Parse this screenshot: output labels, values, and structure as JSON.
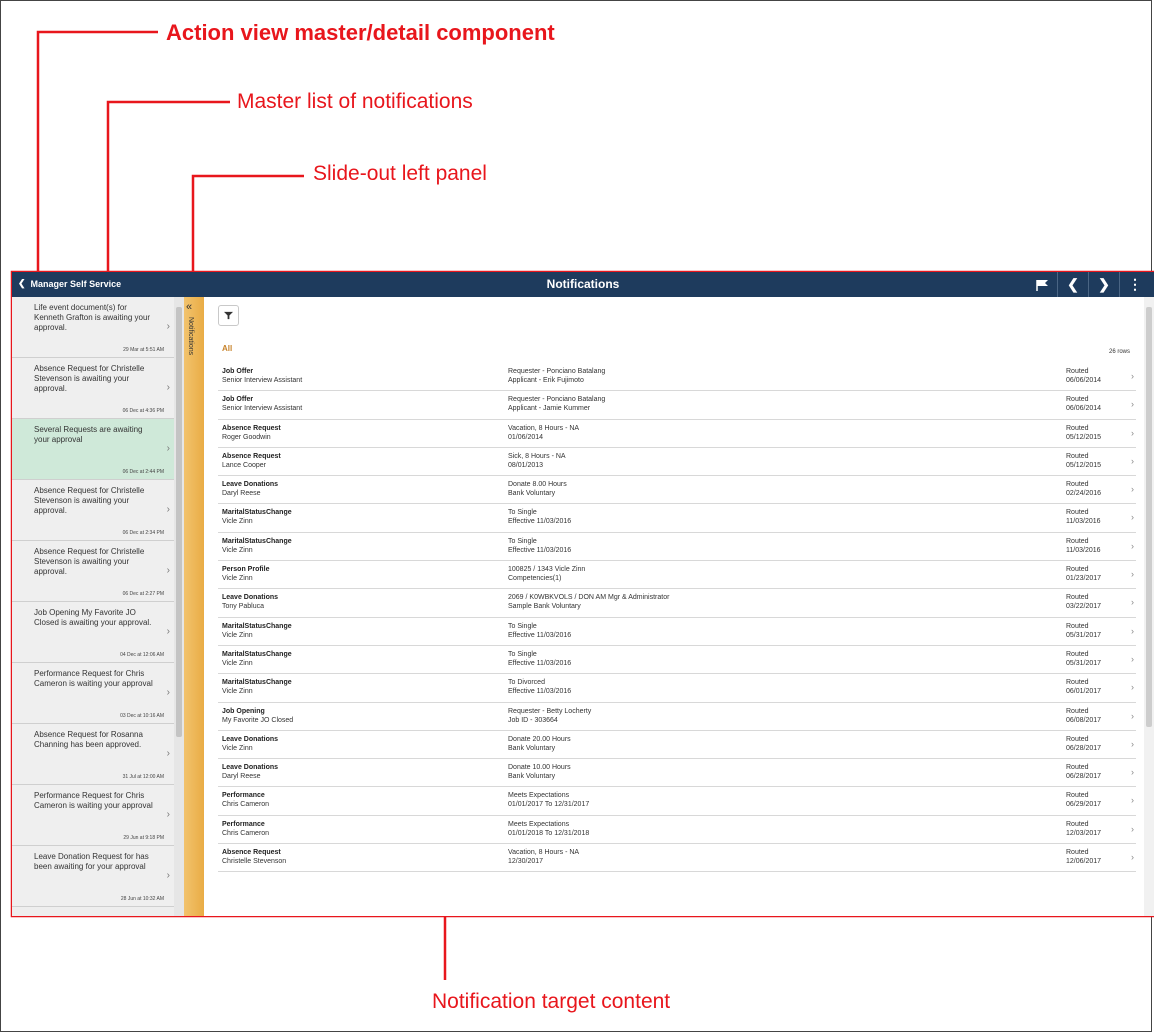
{
  "annotations": {
    "title": "Action view master/detail component",
    "master_list": "Master list of notifications",
    "slide_out": "Slide-out left panel",
    "target": "Notification target content",
    "color": "#e8161c"
  },
  "header": {
    "back_label": "Manager Self Service",
    "title": "Notifications",
    "icons": [
      "flag-icon",
      "chevron-left-icon",
      "chevron-right-icon",
      "more-vertical-icon"
    ],
    "bg_color": "#1e3b5d"
  },
  "slideout": {
    "label": "Notifications"
  },
  "master": {
    "items": [
      {
        "text": "Life event document(s) for Kenneth Grafton is awaiting your approval.",
        "date": "29 Mar at 5:51 AM"
      },
      {
        "text": "Absence Request for Christelle Stevenson is awaiting your approval.",
        "date": "06 Dec at 4:36 PM"
      },
      {
        "text": "Several Requests are awaiting your approval",
        "date": "06 Dec at 2:44 PM",
        "selected": true
      },
      {
        "text": "Absence Request for Christelle Stevenson is awaiting your approval.",
        "date": "06 Dec at 2:34 PM"
      },
      {
        "text": "Absence Request for Christelle Stevenson is awaiting your approval.",
        "date": "06 Dec at 2:27 PM"
      },
      {
        "text": "Job Opening My Favorite JO Closed is awaiting your approval.",
        "date": "04 Dec at 12:06 AM"
      },
      {
        "text": "Performance Request for Chris Cameron is waiting your approval",
        "date": "03 Dec at 10:16 AM"
      },
      {
        "text": "Absence Request for Rosanna Channing has been approved.",
        "date": "31 Jul at 12:00 AM"
      },
      {
        "text": "Performance Request for Chris Cameron is waiting your approval",
        "date": "29 Jun at 9:18 PM"
      },
      {
        "text": "Leave Donation Request for has been awaiting for your approval",
        "date": "28 Jun at 10:32 AM"
      }
    ]
  },
  "detail": {
    "group_label": "All",
    "row_count": "26 rows",
    "rows": [
      {
        "title": "Job Offer",
        "sub": "Senior Interview Assistant",
        "d1": "Requester - Ponciano Batalang",
        "d2": "Applicant - Erik Fujimoto",
        "status": "Routed",
        "date": "06/06/2014"
      },
      {
        "title": "Job Offer",
        "sub": "Senior Interview Assistant",
        "d1": "Requester - Ponciano Batalang",
        "d2": "Applicant - Jamie Kummer",
        "status": "Routed",
        "date": "06/06/2014"
      },
      {
        "title": "Absence Request",
        "sub": "Roger Goodwin",
        "d1": "Vacation, 8 Hours - NA",
        "d2": "01/06/2014",
        "status": "Routed",
        "date": "05/12/2015"
      },
      {
        "title": "Absence Request",
        "sub": "Lance Cooper",
        "d1": "Sick, 8 Hours - NA",
        "d2": "08/01/2013",
        "status": "Routed",
        "date": "05/12/2015"
      },
      {
        "title": "Leave Donations",
        "sub": "Daryl Reese",
        "d1": "Donate  8.00 Hours",
        "d2": "Bank Voluntary",
        "status": "Routed",
        "date": "02/24/2016"
      },
      {
        "title": "MaritalStatusChange",
        "sub": "Vicle Zinn",
        "d1": "To Single",
        "d2": "Effective 11/03/2016",
        "status": "Routed",
        "date": "11/03/2016"
      },
      {
        "title": "MaritalStatusChange",
        "sub": "Vicle Zinn",
        "d1": "To Single",
        "d2": "Effective 11/03/2016",
        "status": "Routed",
        "date": "11/03/2016"
      },
      {
        "title": "Person Profile",
        "sub": "Vicle Zinn",
        "d1": "100825 / 1343  Vicle Zinn",
        "d2": "Competencies(1)",
        "status": "Routed",
        "date": "01/23/2017"
      },
      {
        "title": "Leave Donations",
        "sub": "Tony Pabluca",
        "d1": "2069 / K0WBKVOLS / DON  AM Mgr & Administrator",
        "d2": "Sample Bank Voluntary",
        "status": "Routed",
        "date": "03/22/2017"
      },
      {
        "title": "MaritalStatusChange",
        "sub": "Vicle Zinn",
        "d1": "To Single",
        "d2": "Effective 11/03/2016",
        "status": "Routed",
        "date": "05/31/2017"
      },
      {
        "title": "MaritalStatusChange",
        "sub": "Vicle Zinn",
        "d1": "To Single",
        "d2": "Effective 11/03/2016",
        "status": "Routed",
        "date": "05/31/2017"
      },
      {
        "title": "MaritalStatusChange",
        "sub": "Vicle Zinn",
        "d1": "To Divorced",
        "d2": "Effective 11/03/2016",
        "status": "Routed",
        "date": "06/01/2017"
      },
      {
        "title": "Job Opening",
        "sub": "My Favorite JO Closed",
        "d1": "Requester - Betty Locherty",
        "d2": "Job ID - 303664",
        "status": "Routed",
        "date": "06/08/2017"
      },
      {
        "title": "Leave Donations",
        "sub": "Vicle Zinn",
        "d1": "Donate  20.00 Hours",
        "d2": "Bank Voluntary",
        "status": "Routed",
        "date": "06/28/2017"
      },
      {
        "title": "Leave Donations",
        "sub": "Daryl Reese",
        "d1": "Donate  10.00 Hours",
        "d2": "Bank Voluntary",
        "status": "Routed",
        "date": "06/28/2017"
      },
      {
        "title": "Performance",
        "sub": "Chris Cameron",
        "d1": "Meets Expectations",
        "d2": "01/01/2017 To 12/31/2017",
        "status": "Routed",
        "date": "06/29/2017"
      },
      {
        "title": "Performance",
        "sub": "Chris Cameron",
        "d1": "Meets Expectations",
        "d2": "01/01/2018 To 12/31/2018",
        "status": "Routed",
        "date": "12/03/2017"
      },
      {
        "title": "Absence Request",
        "sub": "Christelle Stevenson",
        "d1": "Vacation, 8 Hours - NA",
        "d2": "12/30/2017",
        "status": "Routed",
        "date": "12/06/2017"
      }
    ]
  }
}
